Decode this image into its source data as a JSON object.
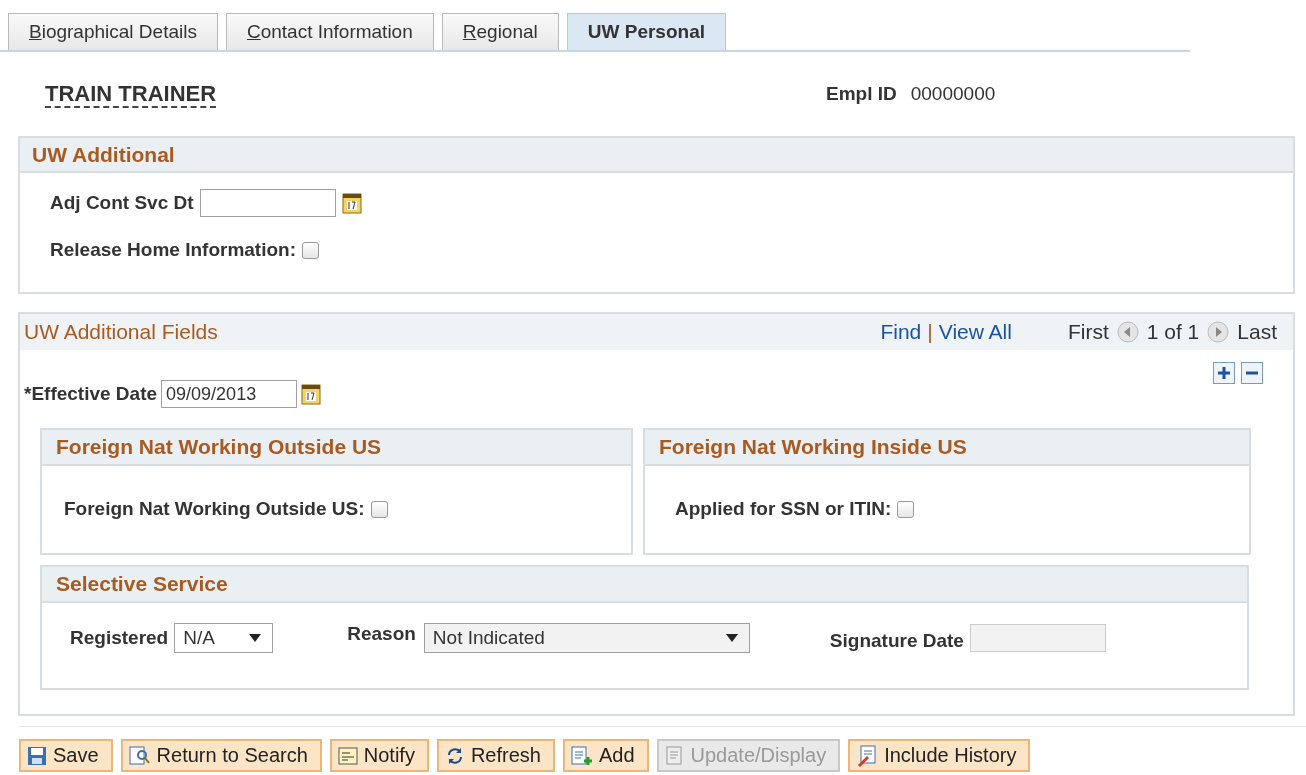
{
  "tabs": [
    {
      "label": "Biographical Details",
      "selected": false,
      "access_key": true
    },
    {
      "label": "Contact Information",
      "selected": false,
      "access_key": true
    },
    {
      "label": "Regional",
      "selected": false,
      "access_key": true
    },
    {
      "label": "UW Personal",
      "selected": true,
      "access_key": false
    }
  ],
  "employee": {
    "name": "TRAIN TRAINER",
    "id_label": "Empl ID",
    "id_value": "00000000"
  },
  "uw_additional": {
    "title": "UW Additional",
    "adj_label": "Adj Cont Svc Dt",
    "release_label": "Release Home Information:",
    "release_checked": false
  },
  "fields": {
    "title": "UW Additional Fields",
    "find": "Find",
    "separator": "|",
    "view_all": "View All",
    "first": "First",
    "count": "1 of 1",
    "last": "Last",
    "effective_label": "*Effective Date",
    "effective_value": "09/09/2013",
    "outside": {
      "title": "Foreign Nat Working Outside US",
      "label": "Foreign Nat Working Outside US:",
      "checked": false
    },
    "inside": {
      "title": "Foreign Nat Working Inside US",
      "label": "Applied for SSN or ITIN:",
      "checked": false
    },
    "selective": {
      "title": "Selective Service",
      "registered_label": "Registered",
      "registered_value": "N/A",
      "reason_label": "Reason",
      "reason_value": "Not Indicated",
      "signature_label": "Signature Date"
    }
  },
  "buttons": [
    {
      "label": "Save",
      "kind": "save",
      "disabled": false
    },
    {
      "label": "Return to Search",
      "kind": "search",
      "disabled": false
    },
    {
      "label": "Notify",
      "kind": "notify",
      "disabled": false
    },
    {
      "label": "Refresh",
      "kind": "refresh",
      "disabled": false
    },
    {
      "label": "Add",
      "kind": "add",
      "disabled": false
    },
    {
      "label": "Update/Display",
      "kind": "update",
      "disabled": true
    },
    {
      "label": "Include History",
      "kind": "history",
      "disabled": false
    }
  ]
}
